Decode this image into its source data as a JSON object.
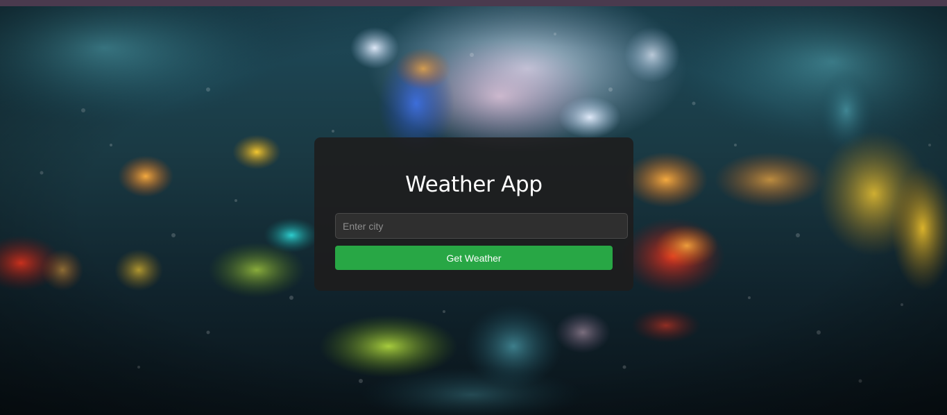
{
  "app": {
    "title": "Weather App"
  },
  "search": {
    "placeholder": "Enter city",
    "value": ""
  },
  "actions": {
    "get_weather_label": "Get Weather"
  },
  "theme": {
    "top_strip_color": "#4a3a4e",
    "card_background": "#1e1c1c",
    "button_color": "#28a745",
    "title_color": "#ffffff"
  },
  "background": {
    "image": "rainy-window-bokeh-city-night"
  }
}
